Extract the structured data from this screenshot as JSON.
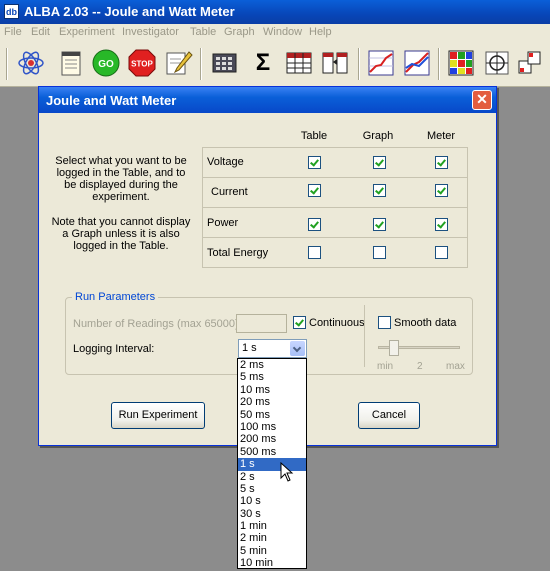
{
  "app": {
    "icon_text": "db",
    "title": "ALBA 2.03 -- Joule and Watt Meter"
  },
  "menu": [
    "File",
    "Edit",
    "Experiment",
    "Investigator",
    "Table",
    "Graph",
    "Window",
    "Help"
  ],
  "toolbar": {
    "go_label": "GO",
    "stop_label": "STOP",
    "sum_label": "Σ"
  },
  "dialog": {
    "title": "Joule and Watt Meter",
    "columns": [
      "Table",
      "Graph",
      "Meter"
    ],
    "description1": "Select what you want to be logged in the Table, and to be displayed during the experiment.",
    "description2": "Note that you cannot display a Graph unless it is also logged in the Table.",
    "rows": [
      {
        "label": "Voltage",
        "table": true,
        "graph": true,
        "meter": true
      },
      {
        "label": "Current",
        "table": true,
        "graph": true,
        "meter": true
      },
      {
        "label": "Power",
        "table": true,
        "graph": true,
        "meter": true
      },
      {
        "label": "Total Energy",
        "table": false,
        "graph": false,
        "meter": false
      }
    ],
    "run_params": {
      "legend": "Run Parameters",
      "num_readings_label": "Number of Readings (max 65000):",
      "num_readings_value": "",
      "continuous_label": "Continuous",
      "continuous_checked": true,
      "smooth_label": "Smooth data",
      "smooth_checked": false,
      "logging_interval_label": "Logging Interval:",
      "logging_interval_value": "1 s",
      "slider_min": "min",
      "slider_mid": "2",
      "slider_max": "max",
      "slider_level": 0.15
    },
    "run_button": "Run Experiment",
    "cancel_button": "Cancel",
    "interval_options": [
      "2 ms",
      "5 ms",
      "10 ms",
      "20 ms",
      "50 ms",
      "100 ms",
      "200 ms",
      "500 ms",
      "1 s",
      "2 s",
      "5 s",
      "10 s",
      "30 s",
      "1 min",
      "2 min",
      "5 min",
      "10 min"
    ],
    "selected_option": "1 s"
  },
  "colors": {
    "titlebar": "#0846b8",
    "accent": "#0046d5",
    "selection": "#316ac5",
    "check": "#21a121",
    "close": "#e35d3f"
  }
}
